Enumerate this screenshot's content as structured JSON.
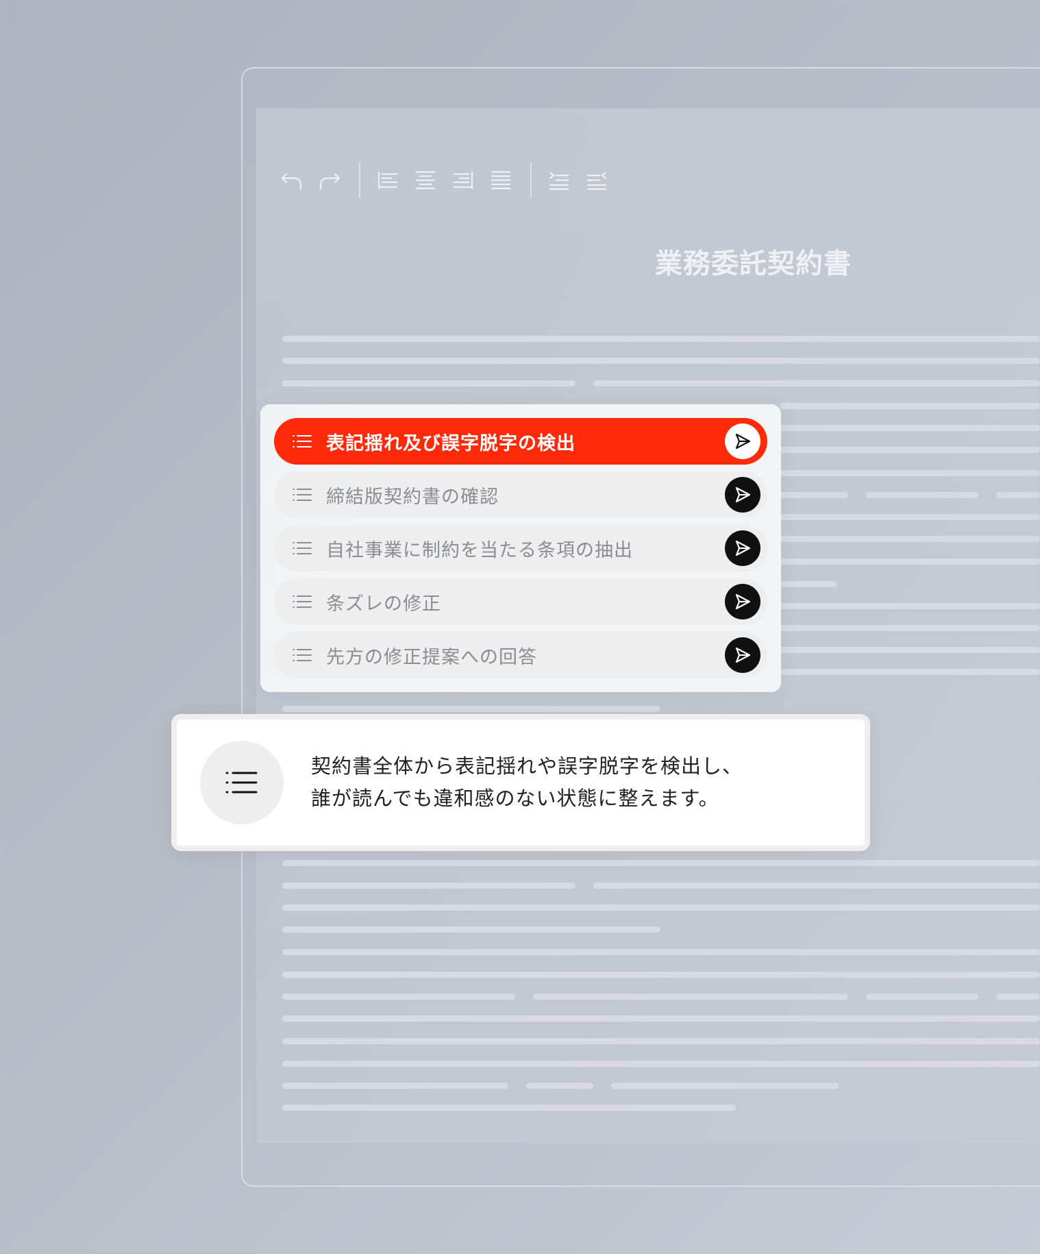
{
  "document": {
    "title": "業務委託契約書"
  },
  "toolbar": {
    "buttons": [
      {
        "name": "undo",
        "icon": "undo-icon"
      },
      {
        "name": "redo",
        "icon": "redo-icon"
      },
      {
        "name": "align-left",
        "icon": "align-left-icon"
      },
      {
        "name": "align-center",
        "icon": "align-center-icon"
      },
      {
        "name": "align-right",
        "icon": "align-right-icon"
      },
      {
        "name": "align-justify",
        "icon": "align-justify-icon"
      },
      {
        "name": "indent",
        "icon": "indent-icon"
      },
      {
        "name": "outdent",
        "icon": "outdent-icon"
      }
    ]
  },
  "suggestions": {
    "items": [
      {
        "label": "表記揺れ及び誤字脱字の検出",
        "active": true
      },
      {
        "label": "締結版契約書の確認",
        "active": false
      },
      {
        "label": "自社事業に制約を当たる条項の抽出",
        "active": false
      },
      {
        "label": "条ズレの修正",
        "active": false
      },
      {
        "label": "先方の修正提案への回答",
        "active": false
      }
    ],
    "item_icon": "list-icon",
    "send_icon": "send-icon"
  },
  "description": {
    "icon": "list-icon",
    "line1": "契約書全体から表記揺れや誤字脱字を検出し、",
    "line2": "誰が読んでも違和感のない状態に整えます。"
  },
  "colors": {
    "accent": "#ff2a0a",
    "send_button": "#111111",
    "item_bg": "#eeeeef"
  }
}
